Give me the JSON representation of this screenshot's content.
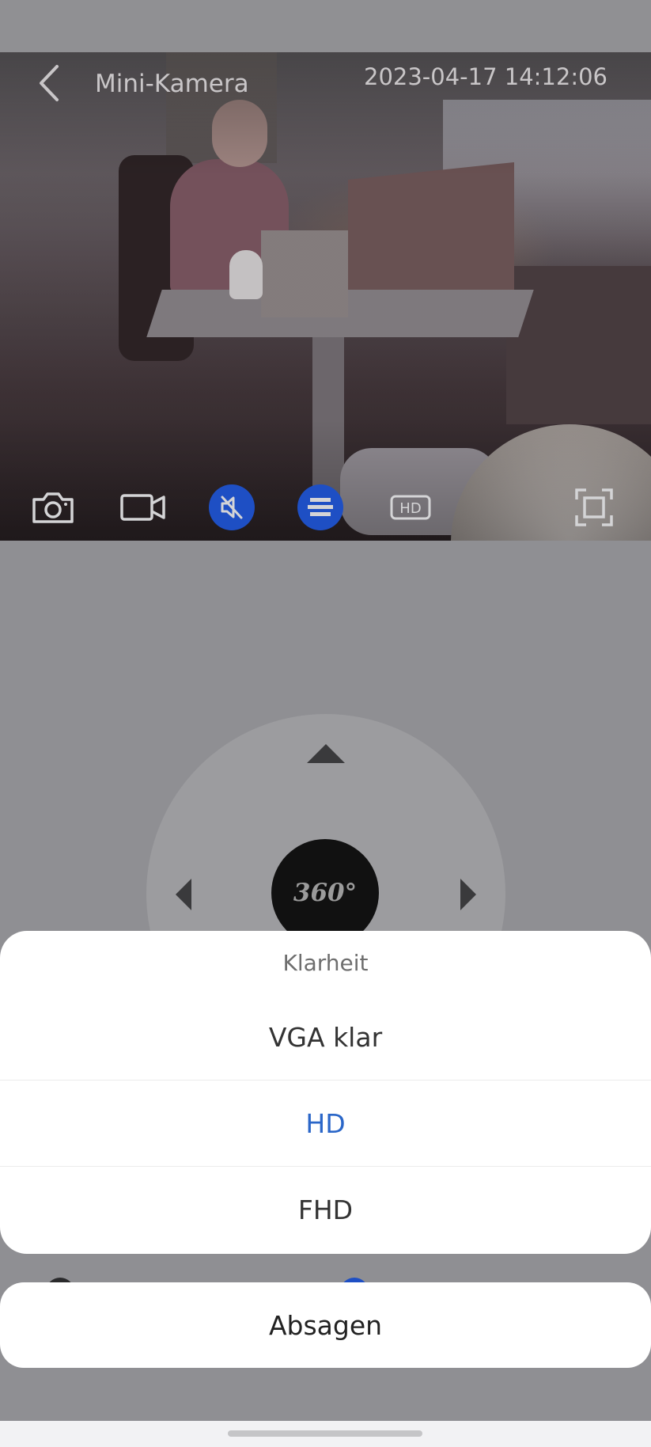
{
  "header": {
    "title": "Mini-Kamera",
    "timestamp": "2023-04-17 14:12:06"
  },
  "video_toolbar": {
    "hd_label": "HD",
    "icons": [
      "camera-icon",
      "video-record-icon",
      "mute-icon",
      "stream-icon",
      "hd-icon",
      "fullscreen-icon"
    ],
    "active_color": "#1e4fc4"
  },
  "ptz": {
    "center_label": "360°"
  },
  "clarity_sheet": {
    "title": "Klarheit",
    "options": [
      {
        "label": "VGA klar",
        "selected": false
      },
      {
        "label": "HD",
        "selected": true
      },
      {
        "label": "FHD",
        "selected": false
      }
    ],
    "selected_color": "#2a66c8"
  },
  "cancel_label": "Absagen"
}
